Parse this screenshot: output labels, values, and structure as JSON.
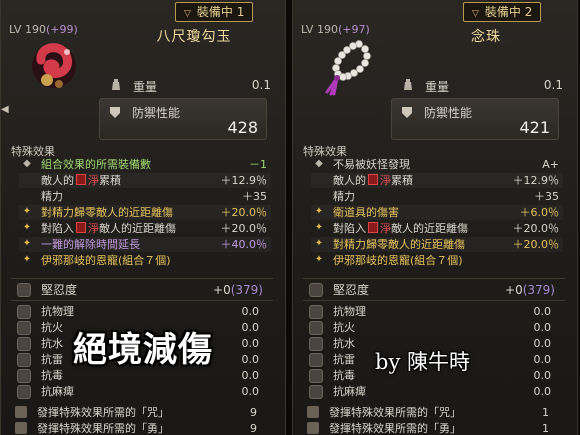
{
  "left": {
    "tag": "裝備中 1",
    "level": "LV 190",
    "level_bonus": "(+99)",
    "name": "八尺瓊勾玉",
    "weight_label": "重量",
    "weight_value": "0.1",
    "defense_label": "防禦性能",
    "defense_value": "428",
    "section_title": "特殊效果",
    "effects": [
      {
        "icon": "gem-icon",
        "text": "組合效果的所需裝備數",
        "value": "－1",
        "color": "green"
      },
      {
        "pre": "敵人的",
        "mid": "淨",
        "post": "累積",
        "value": "＋12.9％",
        "color": "white"
      },
      {
        "text": "精力",
        "value": "＋35",
        "color": "white"
      },
      {
        "icon": "star-icon",
        "text": "對精力歸零敵人的近距離傷",
        "value": "＋20.0％",
        "color": "gold"
      },
      {
        "icon": "star-icon",
        "pre": "對陷入",
        "mid": "淨",
        "post": "敵人的近距離傷",
        "value": "＋20.0％",
        "color": "white"
      },
      {
        "icon": "star-icon",
        "text": "一難的解除時間延長",
        "value": "＋40.0％",
        "color": "purple"
      },
      {
        "icon": "star-icon",
        "text": "伊邪那岐的恩寵(組合７個)",
        "value": "",
        "color": "gold"
      }
    ],
    "toughness_label": "堅忍度",
    "toughness_value": "+0",
    "toughness_paren": "(379)",
    "resists": [
      {
        "label": "抗物理",
        "value": "0.0"
      },
      {
        "label": "抗火",
        "value": "0.0"
      },
      {
        "label": "抗水",
        "value": "0.0"
      },
      {
        "label": "抗雷",
        "value": "0.0"
      },
      {
        "label": "抗毒",
        "value": "0.0"
      },
      {
        "label": "抗麻痺",
        "value": "0.0"
      }
    ],
    "footer": [
      {
        "label": "發揮特殊效果所需的「咒」",
        "value": "9"
      },
      {
        "label": "發揮特殊效果所需的「勇」",
        "value": "9"
      }
    ]
  },
  "right": {
    "tag": "裝備中 2",
    "level": "LV 190",
    "level_bonus": "(+97)",
    "name": "念珠",
    "weight_label": "重量",
    "weight_value": "0.1",
    "defense_label": "防禦性能",
    "defense_value": "421",
    "section_title": "特殊效果",
    "effects": [
      {
        "icon": "gem-icon",
        "text": "不易被妖怪發現",
        "value": "A+",
        "color": "white"
      },
      {
        "pre": "敵人的",
        "mid": "淨",
        "post": "累積",
        "value": "＋12.9％",
        "color": "white"
      },
      {
        "text": "精力",
        "value": "＋35",
        "color": "white"
      },
      {
        "icon": "star-icon",
        "text": "衛道具的傷害",
        "value": "＋6.0％",
        "color": "gold"
      },
      {
        "icon": "star-icon",
        "pre": "對陷入",
        "mid": "淨",
        "post": "敵人的近距離傷",
        "value": "＋20.0％",
        "color": "white"
      },
      {
        "icon": "star-icon",
        "text": "對精力歸零敵人的近距離傷",
        "value": "＋20.0％",
        "color": "gold"
      },
      {
        "icon": "star-icon",
        "text": "伊邪那岐的恩寵(組合７個)",
        "value": "",
        "color": "gold"
      }
    ],
    "toughness_label": "堅忍度",
    "toughness_value": "+0",
    "toughness_paren": "(379)",
    "resists": [
      {
        "label": "抗物理",
        "value": "0.0"
      },
      {
        "label": "抗火",
        "value": "0.0"
      },
      {
        "label": "抗水",
        "value": "0.0"
      },
      {
        "label": "抗雷",
        "value": "0.0"
      },
      {
        "label": "抗毒",
        "value": "0.0"
      },
      {
        "label": "抗麻痺",
        "value": "0.0"
      }
    ],
    "footer": [
      {
        "label": "發揮特殊效果所需的「咒」",
        "value": "1"
      },
      {
        "label": "發揮特殊效果所需的「勇」",
        "value": "1"
      }
    ]
  },
  "overlay": {
    "title": "絕境減傷",
    "author": "by 陳牛時"
  },
  "colors": {
    "gold": "#e6c25a",
    "green": "#9fd870",
    "purple": "#c29ae0",
    "red": "#e05050",
    "tag_border": "#b89a52"
  }
}
